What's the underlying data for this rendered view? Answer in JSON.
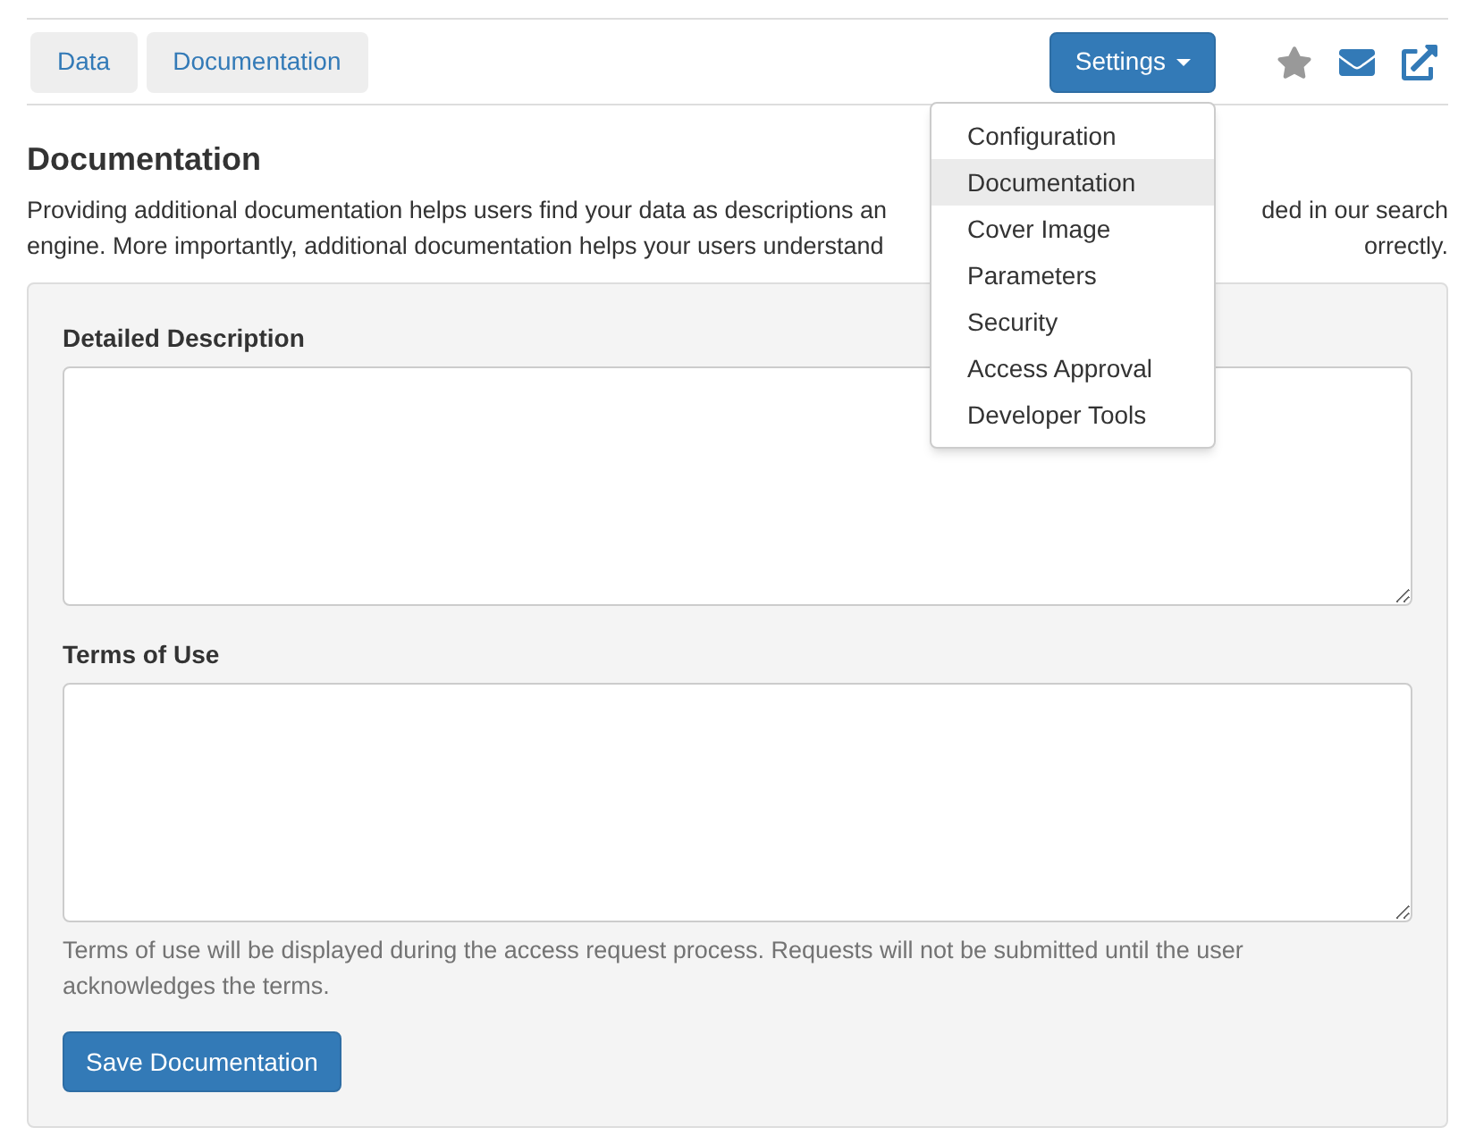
{
  "tabs": [
    {
      "label": "Data"
    },
    {
      "label": "Documentation"
    }
  ],
  "settings_button": {
    "label": "Settings"
  },
  "settings_menu": [
    {
      "label": "Configuration",
      "selected": false
    },
    {
      "label": "Documentation",
      "selected": true
    },
    {
      "label": "Cover Image",
      "selected": false
    },
    {
      "label": "Parameters",
      "selected": false
    },
    {
      "label": "Security",
      "selected": false
    },
    {
      "label": "Access Approval",
      "selected": false
    },
    {
      "label": "Developer Tools",
      "selected": false
    }
  ],
  "heading": "Documentation",
  "intro_lines": [
    {
      "left": "Providing additional documentation helps users find your data as descriptions an",
      "right": "ded in our search"
    },
    {
      "left": "engine. More importantly, additional documentation helps your users understand",
      "right": "orrectly."
    }
  ],
  "fields": [
    {
      "label": "Detailed Description"
    },
    {
      "label": "Terms of Use",
      "help": "Terms of use will be displayed during the access request process. Requests will not be submitted until the user acknowledges the terms."
    }
  ],
  "save_button": "Save Documentation"
}
